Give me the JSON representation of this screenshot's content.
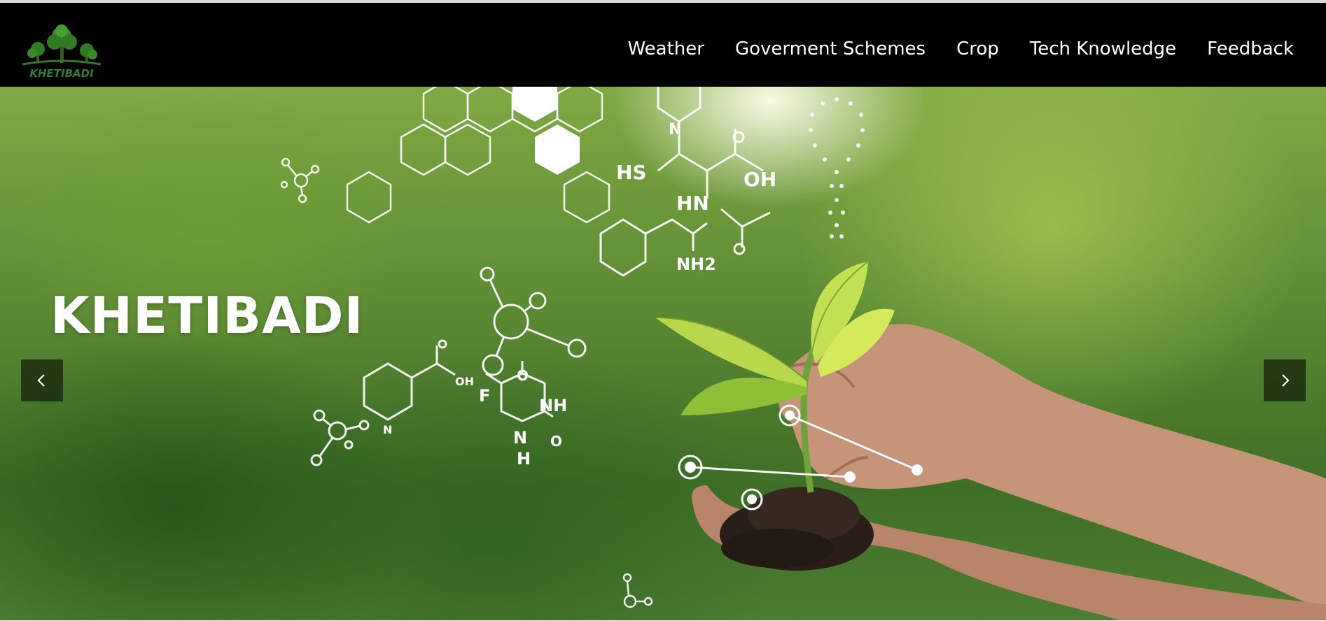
{
  "brand": {
    "logo_icon": "tree-logo-icon",
    "logo_text": "KHETIBADI"
  },
  "nav": {
    "items": [
      {
        "label": "Weather"
      },
      {
        "label": "Goverment Schemes"
      },
      {
        "label": "Crop"
      },
      {
        "label": "Tech Knowledge"
      },
      {
        "label": "Feedback"
      }
    ]
  },
  "hero": {
    "title": "KHETIBADI",
    "prev_icon": "chevron-left-icon",
    "next_icon": "chevron-right-icon"
  },
  "colors": {
    "navbar_bg": "#000000",
    "nav_text": "#ffffff",
    "hero_green": "#5d8b34",
    "logo_green": "#2e7d32"
  }
}
